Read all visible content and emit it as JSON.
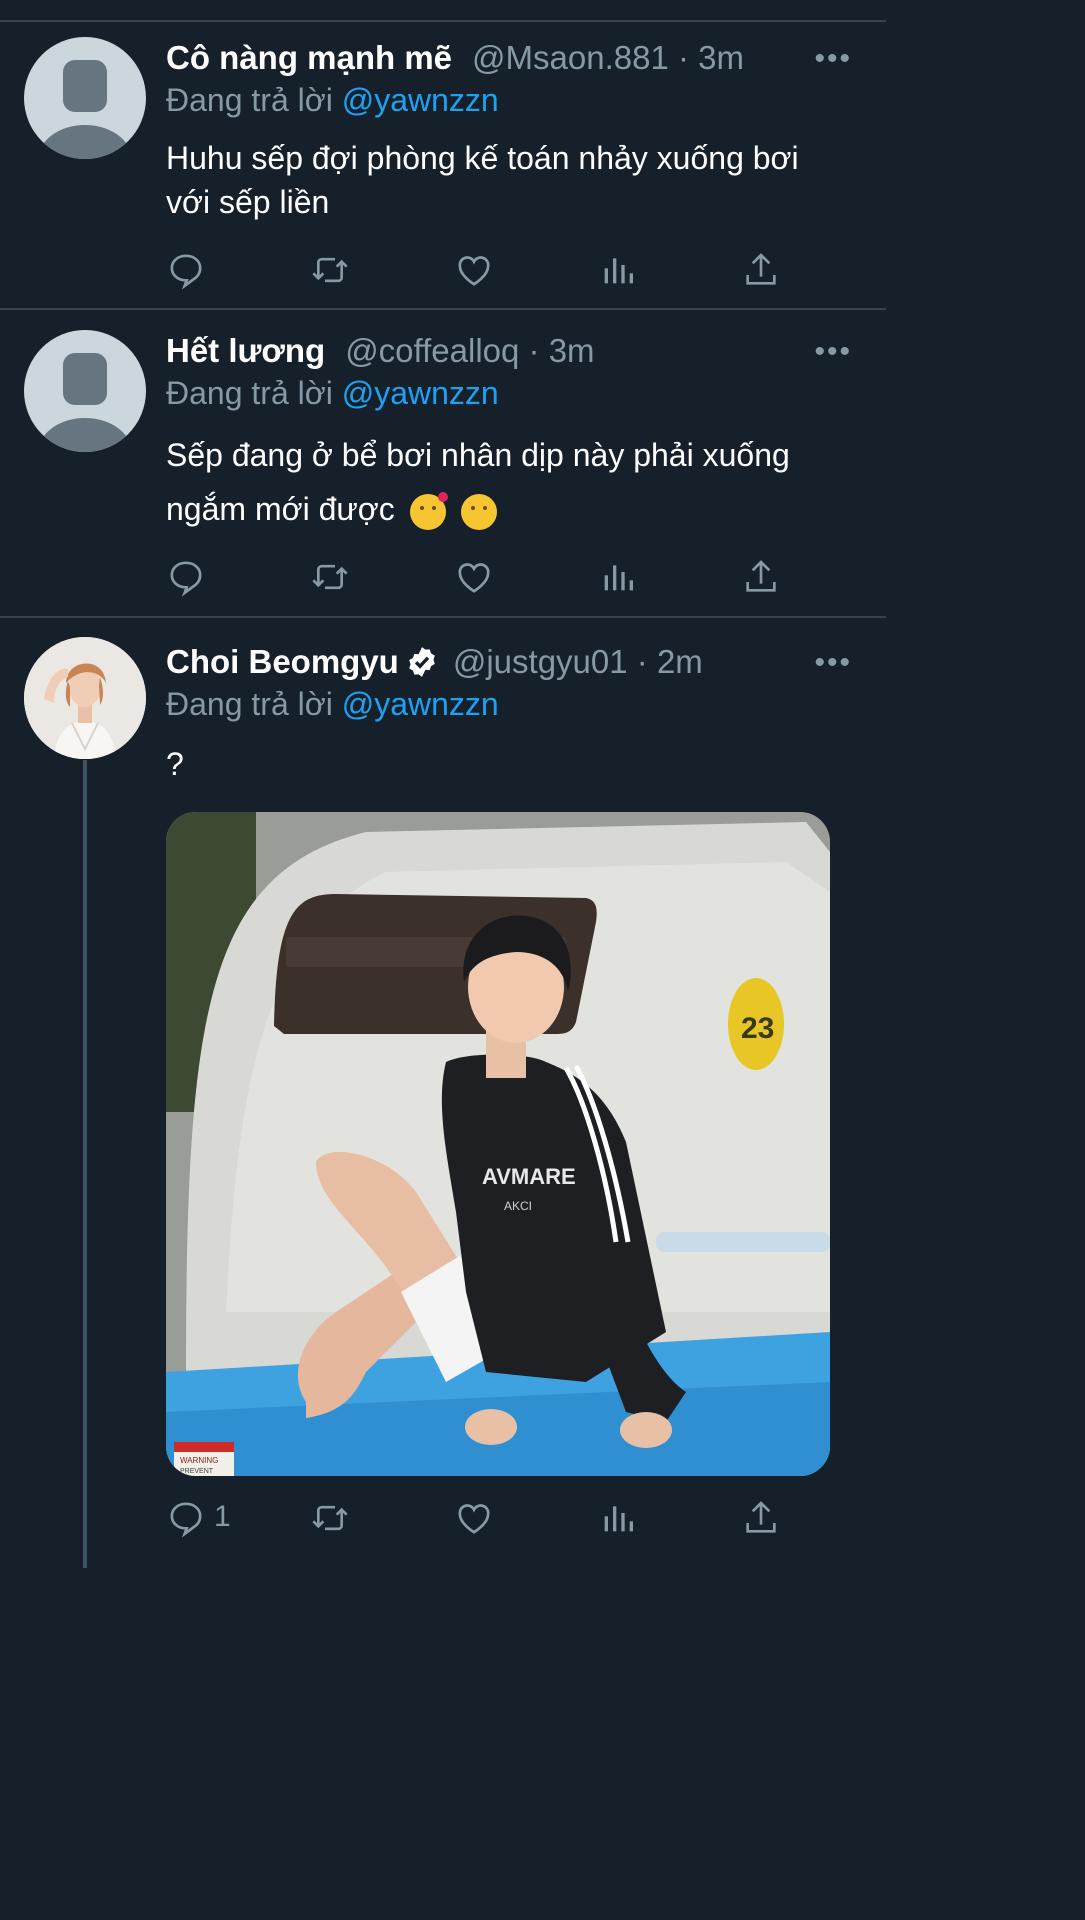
{
  "tweets": [
    {
      "name": "Cô nàng mạnh mẽ",
      "handle": "@Msaon.881",
      "time": "3m",
      "reply_prefix": "Đang trả lời",
      "reply_to": "@yawnzzn",
      "text": "Huhu sếp đợi phòng kế toán nhảy xuống bơi với sếp liền",
      "avatar": "default-avatar"
    },
    {
      "name": "Hết lương",
      "handle": "@coffealloq",
      "time": "3m",
      "reply_prefix": "Đang trả lời",
      "reply_to": "@yawnzzn",
      "text": "Sếp đang ở bể bơi nhân dịp này phải xuống ngắm mới được",
      "emojis": [
        "face-blowing-kiss",
        "face-savoring-food"
      ],
      "avatar": "default-avatar"
    },
    {
      "name": "Choi Beomgyu",
      "verified": true,
      "handle": "@justgyu01",
      "time": "2m",
      "reply_prefix": "Đang trả lời",
      "reply_to": "@yawnzzn",
      "text": "?",
      "reply_count": "1",
      "avatar": "profile-photo",
      "image": {
        "description_icon": "photo",
        "sign_text": "23",
        "shirt_text": "AVMARE",
        "shirt_subtext": "AKCI",
        "warning_text": "WARNING",
        "warning_subtext": "PREVENT"
      }
    }
  ],
  "separator": "·",
  "more_glyph": "•••",
  "colors": {
    "background": "#15202b",
    "mention": "#1da1f2",
    "muted": "#8899a6",
    "divider": "#38444d"
  }
}
